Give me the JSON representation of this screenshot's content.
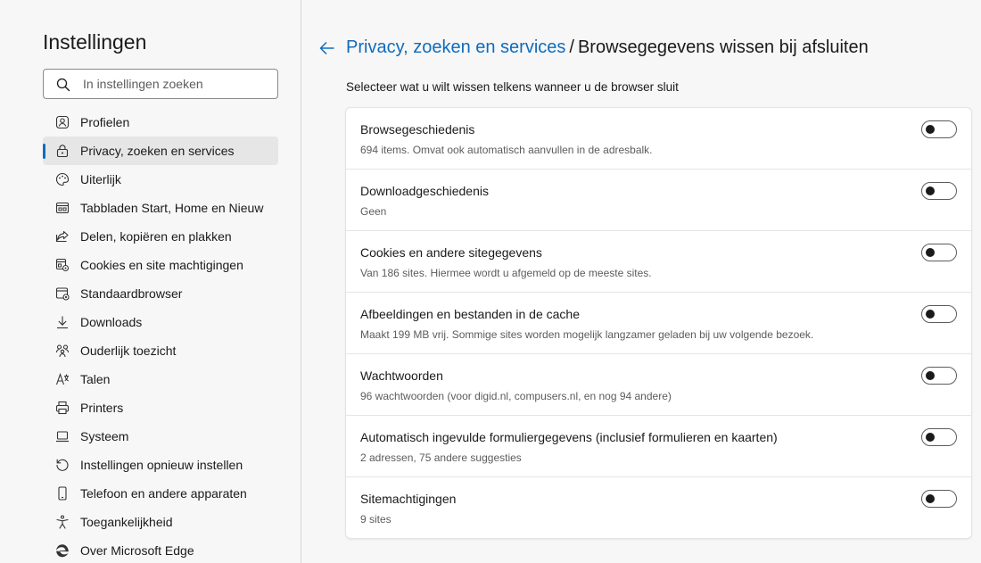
{
  "sidebar": {
    "title": "Instellingen",
    "search_placeholder": "In instellingen zoeken",
    "items": [
      {
        "label": "Profielen",
        "icon": "profile-icon"
      },
      {
        "label": "Privacy, zoeken en services",
        "icon": "lock-icon",
        "active": true
      },
      {
        "label": "Uiterlijk",
        "icon": "palette-icon"
      },
      {
        "label": "Tabbladen Start, Home en Nieuw",
        "icon": "tab-page-icon"
      },
      {
        "label": "Delen, kopiëren en plakken",
        "icon": "share-icon"
      },
      {
        "label": "Cookies en site machtigingen",
        "icon": "cookie-permissions-icon"
      },
      {
        "label": "Standaardbrowser",
        "icon": "default-browser-icon"
      },
      {
        "label": "Downloads",
        "icon": "download-icon"
      },
      {
        "label": "Ouderlijk toezicht",
        "icon": "family-icon"
      },
      {
        "label": "Talen",
        "icon": "language-icon"
      },
      {
        "label": "Printers",
        "icon": "printer-icon"
      },
      {
        "label": "Systeem",
        "icon": "laptop-icon"
      },
      {
        "label": "Instellingen opnieuw instellen",
        "icon": "reset-icon"
      },
      {
        "label": "Telefoon en andere apparaten",
        "icon": "phone-icon"
      },
      {
        "label": "Toegankelijkheid",
        "icon": "accessibility-icon"
      },
      {
        "label": "Over Microsoft Edge",
        "icon": "edge-logo-icon"
      }
    ]
  },
  "header": {
    "breadcrumb": "Privacy, zoeken en services",
    "separator": "/",
    "title": "Browsegegevens wissen bij afsluiten",
    "subtitle": "Selecteer wat u wilt wissen telkens wanneer u de browser sluit"
  },
  "options": [
    {
      "title": "Browsegeschiedenis",
      "desc": "694 items. Omvat ook automatisch aanvullen in de adresbalk.",
      "on": false
    },
    {
      "title": "Downloadgeschiedenis",
      "desc": "Geen",
      "on": false
    },
    {
      "title": "Cookies en andere sitegegevens",
      "desc": "Van 186 sites. Hiermee wordt u afgemeld op de meeste sites.",
      "on": false
    },
    {
      "title": "Afbeeldingen en bestanden in de cache",
      "desc": "Maakt 199 MB vrij. Sommige sites worden mogelijk langzamer geladen bij uw volgende bezoek.",
      "on": false
    },
    {
      "title": "Wachtwoorden",
      "desc": "96 wachtwoorden (voor digid.nl, compusers.nl, en nog 94 andere)",
      "on": false
    },
    {
      "title": "Automatisch ingevulde formuliergegevens (inclusief formulieren en kaarten)",
      "desc": "2 adressen, 75 andere suggesties",
      "on": false
    },
    {
      "title": "Sitemachtigingen",
      "desc": "9 sites",
      "on": false
    }
  ],
  "colors": {
    "accent": "#0f6cbd",
    "sidebar_bg": "#f7f7f7",
    "card_bg": "#ffffff",
    "active_item_bg": "#e6e6e6"
  }
}
